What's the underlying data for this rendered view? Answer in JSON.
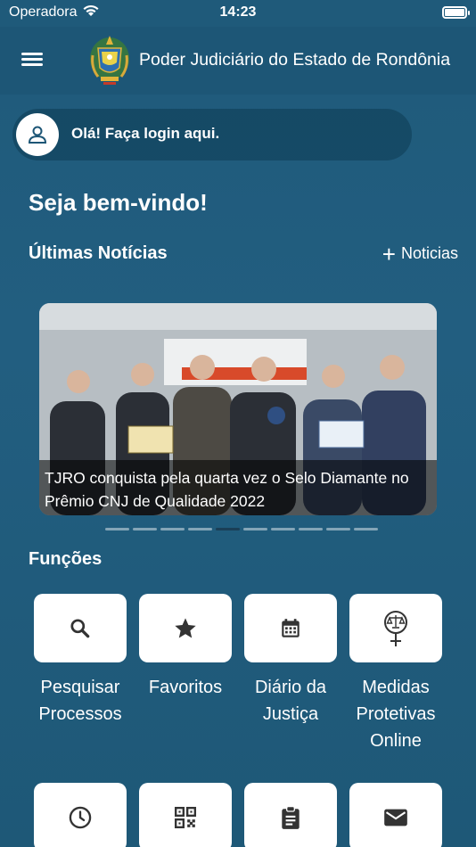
{
  "status_bar": {
    "carrier": "Operadora",
    "time": "14:23",
    "icons": [
      "wifi-icon",
      "battery-icon"
    ]
  },
  "header": {
    "title": "Poder Judiciário do Estado de Rondônia",
    "icons": [
      "menu-icon",
      "coat-of-arms-logo"
    ]
  },
  "login": {
    "label": "Olá! Faça login aqui.",
    "icon": "user-icon"
  },
  "welcome": "Seja bem-vindo!",
  "news": {
    "title": "Últimas Notícias",
    "more_label": "Noticias",
    "more_icon": "plus-icon",
    "current_caption": "TJRO conquista pela quarta vez o Selo Diamante no Prêmio CNJ de Qualidade 2022",
    "page_count": 10,
    "active_page": 5
  },
  "functions": {
    "title": "Funções",
    "items": [
      {
        "label": "Pesquisar Processos",
        "icon": "search-icon"
      },
      {
        "label": "Favoritos",
        "icon": "star-icon"
      },
      {
        "label": "Diário da Justiça",
        "icon": "calendar-icon"
      },
      {
        "label": "Medidas Protetivas Online",
        "icon": "female-justice-icon"
      },
      {
        "label": "",
        "icon": "clock-icon"
      },
      {
        "label": "",
        "icon": "qr-code-icon"
      },
      {
        "label": "",
        "icon": "clipboard-icon"
      },
      {
        "label": "",
        "icon": "mail-icon"
      }
    ]
  },
  "colors": {
    "background": "#225e80",
    "header": "#1d5676",
    "tile": "#ffffff",
    "icon": "#333333"
  }
}
